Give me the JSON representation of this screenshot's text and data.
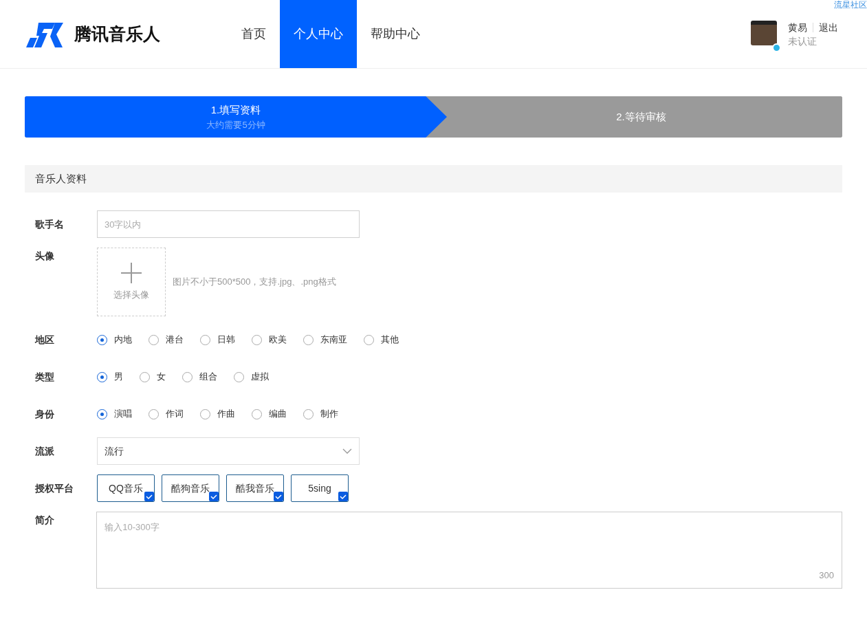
{
  "corner_link": "流星社区",
  "header": {
    "logo_text": "腾讯音乐人",
    "nav": [
      {
        "label": "首页",
        "selected": false
      },
      {
        "label": "个人中心",
        "selected": true
      },
      {
        "label": "帮助中心",
        "selected": false
      }
    ],
    "user": {
      "name": "黄易",
      "logout": "退出",
      "status": "未认证"
    }
  },
  "steps": [
    {
      "title": "1.填写资料",
      "subtitle": "大约需要5分钟",
      "selected": true
    },
    {
      "title": "2.等待审核",
      "selected": false
    }
  ],
  "section": {
    "title": "音乐人资料"
  },
  "fields": [
    {
      "kind": "text",
      "label": "歌手名",
      "placeholder": "30字以内"
    },
    {
      "kind": "upload",
      "label": "头像",
      "button": "选择头像",
      "hint": "图片不小于500*500，支持.jpg、.png格式"
    },
    {
      "kind": "radio",
      "label": "地区",
      "options": [
        {
          "label": "内地",
          "selected": true
        },
        {
          "label": "港台",
          "selected": false
        },
        {
          "label": "日韩",
          "selected": false
        },
        {
          "label": "欧美",
          "selected": false
        },
        {
          "label": "东南亚",
          "selected": false
        },
        {
          "label": "其他",
          "selected": false
        }
      ]
    },
    {
      "kind": "radio",
      "label": "类型",
      "options": [
        {
          "label": "男",
          "selected": true
        },
        {
          "label": "女",
          "selected": false
        },
        {
          "label": "组合",
          "selected": false
        },
        {
          "label": "虚拟",
          "selected": false
        }
      ]
    },
    {
      "kind": "radio",
      "label": "身份",
      "options": [
        {
          "label": "演唱",
          "selected": true
        },
        {
          "label": "作词",
          "selected": false
        },
        {
          "label": "作曲",
          "selected": false
        },
        {
          "label": "编曲",
          "selected": false
        },
        {
          "label": "制作",
          "selected": false
        }
      ]
    },
    {
      "kind": "select",
      "label": "流派",
      "value": "流行"
    },
    {
      "kind": "checkboxes",
      "label": "授权平台",
      "options": [
        {
          "label": "QQ音乐",
          "checked": true
        },
        {
          "label": "酷狗音乐",
          "checked": true
        },
        {
          "label": "酷我音乐",
          "checked": true
        },
        {
          "label": "5sing",
          "checked": true
        }
      ]
    },
    {
      "kind": "textarea",
      "label": "简介",
      "placeholder": "输入10-300字",
      "counter": "300"
    }
  ]
}
